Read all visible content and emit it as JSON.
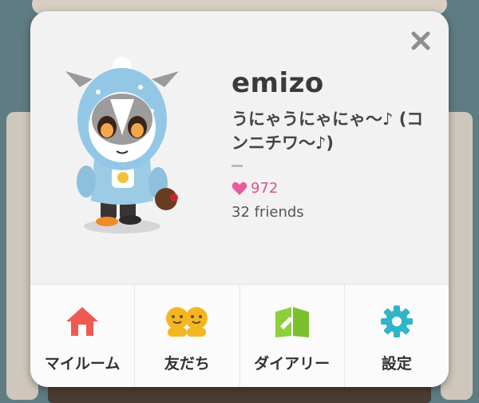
{
  "profile": {
    "username": "emizo",
    "status_message": "うにゃうにゃにゃ〜♪ (コンニチワ〜♪)",
    "likes_count": "972",
    "friends_text": "32 friends"
  },
  "nav": [
    {
      "label": "マイルーム",
      "icon": "house-icon",
      "color": "#ef5a50"
    },
    {
      "label": "友だち",
      "icon": "friends-icon",
      "color": "#f4b721"
    },
    {
      "label": "ダイアリー",
      "icon": "diary-icon",
      "color": "#8ccf3a"
    },
    {
      "label": "設定",
      "icon": "gear-icon",
      "color": "#30b5c8"
    }
  ],
  "colors": {
    "accent_pink": "#e0508f",
    "dialog_bg": "#f2f2f2"
  }
}
